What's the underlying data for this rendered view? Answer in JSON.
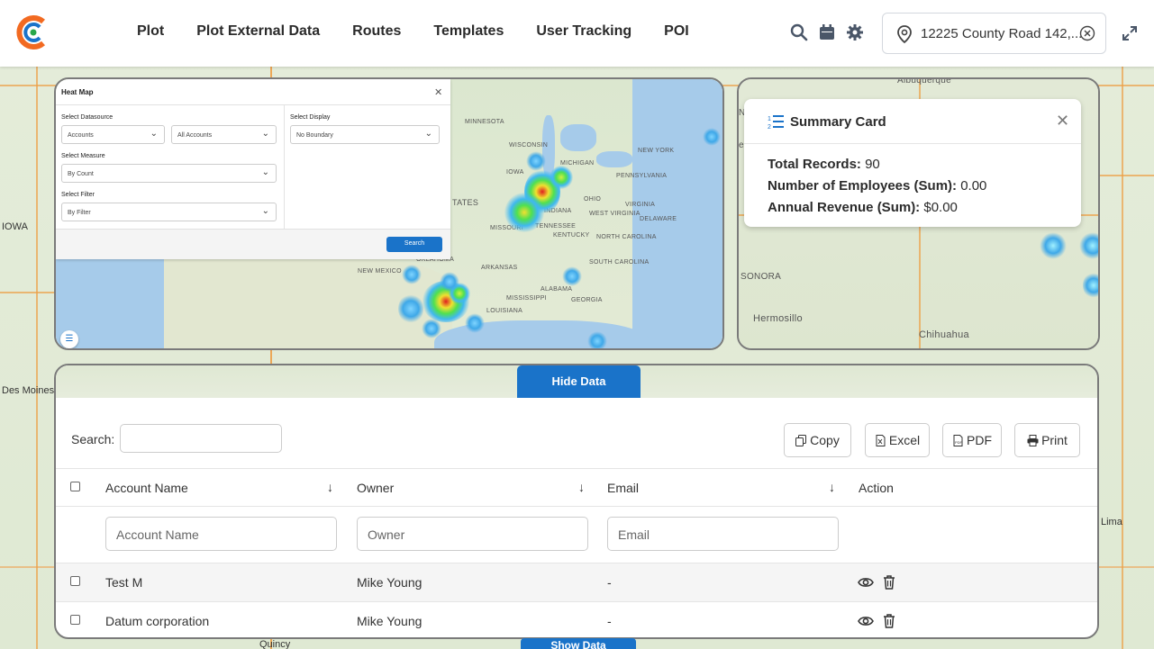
{
  "nav": [
    "Plot",
    "Plot External Data",
    "Routes",
    "Templates",
    "User Tracking",
    "POI"
  ],
  "location": {
    "value": "12225 County Road 142,..."
  },
  "background_labels": [
    "IOWA",
    "Des Moines",
    "Quincy",
    "Lima",
    "Albuquerque"
  ],
  "heatmap": {
    "title": "Heat Map",
    "datasource_label": "Select Datasource",
    "datasource_value": "Accounts",
    "accounts_value": "All Accounts",
    "display_label": "Select Display",
    "display_value": "No Boundary",
    "measure_label": "Select Measure",
    "measure_value": "By Count",
    "filter_label": "Select Filter",
    "filter_value": "By Filter",
    "search_label": "Search",
    "map_labels": [
      "WISCONSIN",
      "MINNESOTA",
      "MICHIGAN",
      "TATES",
      "INDIANA",
      "OHIO",
      "MISSOURI",
      "KENTUCKY",
      "TENNESSEE",
      "ARKANSAS",
      "OKLAHOMA",
      "NEW MEXICO",
      "ALABAMA",
      "GEORGIA",
      "MISSISSIPPI",
      "VIRGINIA",
      "WEST VIRGINIA",
      "DELAWARE",
      "NORTH CAROLINA",
      "SOUTH CAROLINA",
      "IOWA",
      "NEW YORK",
      "PENNSYLVANIA",
      "LOUISIANA"
    ]
  },
  "summary": {
    "title": "Summary Card",
    "rows": [
      {
        "label": "Total Records:",
        "value": "90"
      },
      {
        "label": "Number of Employees (Sum):",
        "value": "0.00"
      },
      {
        "label": "Annual Revenue (Sum):",
        "value": "$0.00"
      }
    ],
    "map_labels": [
      "Albuquerque",
      "SONORA",
      "Hermosillo",
      "Chihuahua",
      "NA",
      "enix"
    ]
  },
  "table": {
    "hide_label": "Hide Data",
    "show_label": "Show Data",
    "search_label": "Search:",
    "buttons": [
      "Copy",
      "Excel",
      "PDF",
      "Print"
    ],
    "columns": [
      "Account Name",
      "Owner",
      "Email",
      "Action"
    ],
    "filters": [
      "Account Name",
      "Owner",
      "Email"
    ],
    "rows": [
      {
        "account": "Test M",
        "owner": "Mike Young",
        "email": "-"
      },
      {
        "account": "Datum corporation",
        "owner": "Mike Young",
        "email": "-"
      }
    ]
  },
  "colors": {
    "primary": "#1a73c9",
    "logo_orange": "#f26a21",
    "logo_green": "#2aa84a"
  }
}
